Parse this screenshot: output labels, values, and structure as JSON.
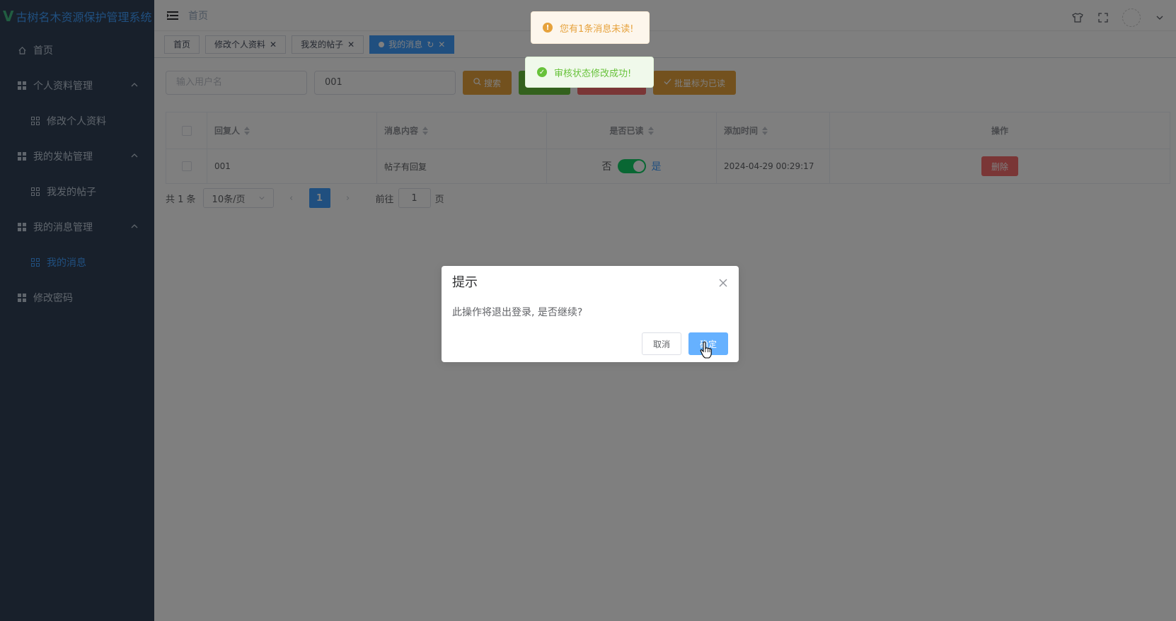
{
  "app": {
    "logo_mark": "V",
    "title": "古树名木资源保护管理系统"
  },
  "sidebar": {
    "items": [
      {
        "label": "首页"
      },
      {
        "label": "个人资料管理"
      },
      {
        "label": "修改个人资料"
      },
      {
        "label": "我的发帖管理"
      },
      {
        "label": "我发的帖子"
      },
      {
        "label": "我的消息管理"
      },
      {
        "label": "我的消息"
      },
      {
        "label": "修改密码"
      }
    ]
  },
  "navbar": {
    "breadcrumb": "首页"
  },
  "tags": [
    {
      "label": "首页"
    },
    {
      "label": "修改个人资料"
    },
    {
      "label": "我发的帖子"
    },
    {
      "label": "我的消息"
    }
  ],
  "filters": {
    "username_placeholder": "输入用户名",
    "message_value": "001",
    "search_label": "搜索",
    "batch_read_label": "批量标为已读"
  },
  "table": {
    "headers": [
      "回复人",
      "消息内容",
      "是否已读",
      "添加时间",
      "操作"
    ],
    "rows": [
      {
        "replier": "001",
        "content": "帖子有回复",
        "read_off": "否",
        "read_on": "是",
        "read": true,
        "time": "2024-04-29 00:29:17",
        "action": "删除"
      }
    ]
  },
  "pagination": {
    "total": "共 1 条",
    "page_size": "10条/页",
    "current_page": "1",
    "goto_prefix": "前往",
    "goto_value": "1",
    "goto_suffix": "页"
  },
  "toasts": {
    "warning": "您有1条消息未读!",
    "success": "审核状态修改成功!"
  },
  "dialog": {
    "title": "提示",
    "message": "此操作将退出登录, 是否继续?",
    "cancel": "取消",
    "confirm": "确定"
  },
  "colors": {
    "sidebar_bg": "#304156",
    "primary": "#409eff",
    "warning": "#e6a23c",
    "success": "#67c23a",
    "danger": "#f56c6c",
    "switch_on": "#13ce66"
  }
}
